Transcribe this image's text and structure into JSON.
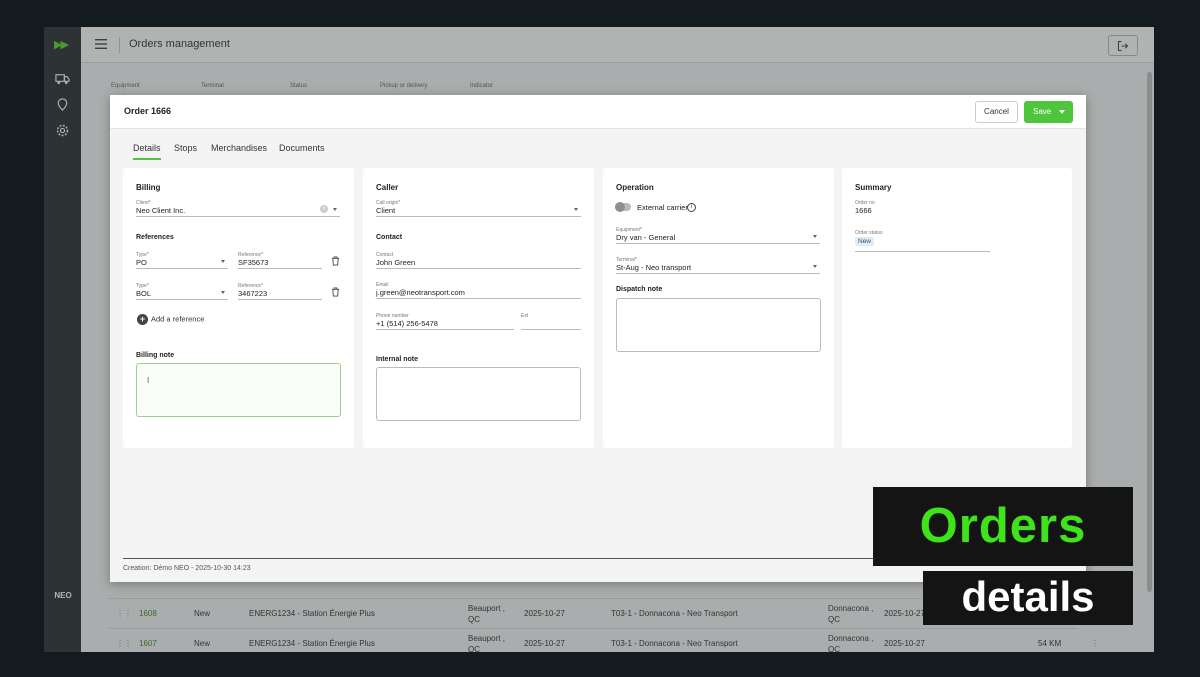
{
  "topbar": {
    "title": "Orders management"
  },
  "rail": {
    "brand": "NEO"
  },
  "filters": {
    "labels": [
      "Equipment",
      "Terminal",
      "Status",
      "Pickup or delivery",
      "Indicator"
    ]
  },
  "background_rows": [
    {
      "id": "1608",
      "status": "New",
      "client": "ENERG1234 - Station Énergie Plus",
      "city": "Beauport , QC",
      "date": "2025-10-27",
      "terminal": "T03-1 - Donnacona - Neo Transport",
      "dest": "Donnacona , QC",
      "date2": "2025-10-27",
      "dist": ""
    },
    {
      "id": "1607",
      "status": "New",
      "client": "ENERG1234 - Station Énergie Plus",
      "city": "Beauport , QC",
      "date": "2025-10-27",
      "terminal": "T03-1 - Donnacona - Neo Transport",
      "dest": "Donnacona , QC",
      "date2": "2025-10-27",
      "dist": "54 KM"
    }
  ],
  "modal": {
    "title": "Order 1666",
    "cancel": "Cancel",
    "save": "Save",
    "tabs": [
      "Details",
      "Stops",
      "Merchandises",
      "Documents"
    ],
    "footer": "Creation: Démo NEO - 2025-10-30 14:23"
  },
  "billing": {
    "title": "Billing",
    "client_label": "Client*",
    "client_value": "Neo Client Inc.",
    "references_title": "References",
    "references": [
      {
        "type_label": "Type*",
        "type": "PO",
        "ref_label": "Reference*",
        "ref": "SF35673"
      },
      {
        "type_label": "Type*",
        "type": "BOL",
        "ref_label": "Reference*",
        "ref": "3467223"
      }
    ],
    "add_reference": "Add a reference",
    "note_title": "Billing note",
    "note_value": "I"
  },
  "caller": {
    "title": "Caller",
    "origin_label": "Call origin*",
    "origin_value": "Client",
    "contact_title": "Contact",
    "contact_label": "Contact",
    "contact_value": "John Green",
    "email_label": "Email",
    "email_value": "j.green@neotransport.com",
    "phone_label": "Phone number",
    "phone_value": "+1 (514) 256-5478",
    "ext_label": "Ext",
    "ext_value": "",
    "internal_note_title": "Internal note"
  },
  "operation": {
    "title": "Operation",
    "external_carrier": "External carrier",
    "equipment_label": "Equipment*",
    "equipment_value": "Dry van - General",
    "terminal_label": "Terminal*",
    "terminal_value": "St-Aug - Neo transport",
    "dispatch_title": "Dispatch note"
  },
  "summary": {
    "title": "Summary",
    "order_no_label": "Order no",
    "order_no_value": "1666",
    "status_label": "Order status",
    "status_value": "New"
  },
  "promo": {
    "line1": "Orders",
    "line2": "details"
  },
  "colors": {
    "accent": "#4fc53d",
    "rail": "#2b3133",
    "promo_green": "#3ee31a"
  }
}
